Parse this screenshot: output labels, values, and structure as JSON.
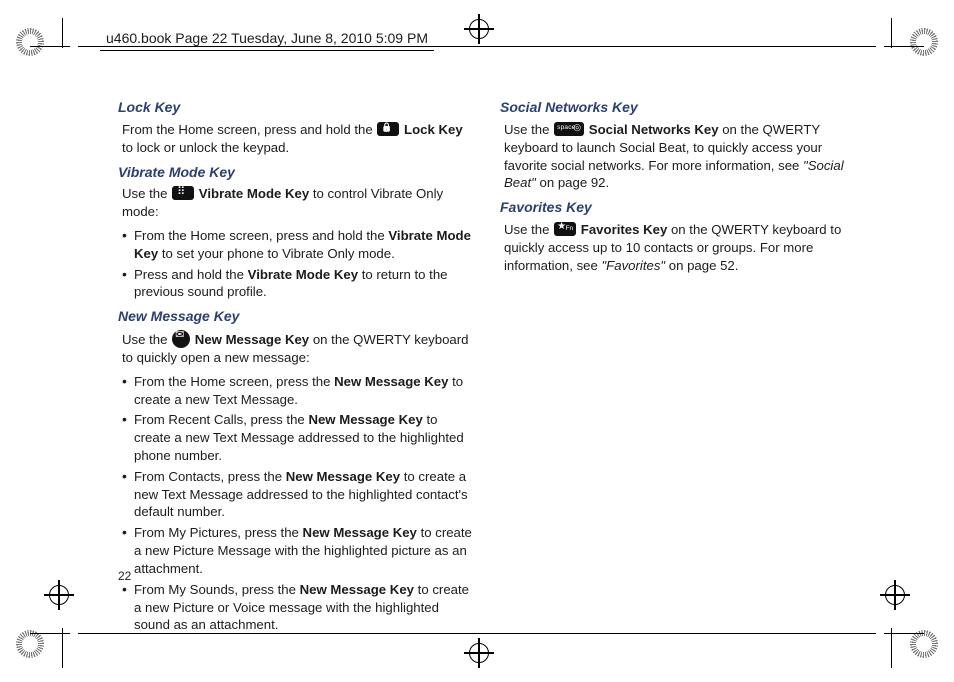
{
  "running_header": "u460.book  Page 22  Tuesday, June 8, 2010  5:09 PM",
  "page_number": "22",
  "left": {
    "lock": {
      "heading": "Lock Key",
      "p1a": "From the Home screen, press and hold the ",
      "p1b": " Lock Key",
      "p1c": " to lock or unlock the keypad."
    },
    "vibrate": {
      "heading": "Vibrate Mode Key",
      "p1a": "Use the ",
      "p1b": " Vibrate Mode Key",
      "p1c": " to control Vibrate Only mode:",
      "li1a": "From the Home screen, press and hold the ",
      "li1b": "Vibrate Mode Key",
      "li1c": " to set your phone to Vibrate Only mode.",
      "li2a": "Press and hold the ",
      "li2b": "Vibrate Mode Key",
      "li2c": " to return to the previous sound profile."
    },
    "newmsg": {
      "heading": "New Message Key",
      "p1a": "Use the ",
      "p1b": " New Message Key",
      "p1c": " on the QWERTY keyboard to quickly open a new message:",
      "li1a": "From the Home screen, press the ",
      "li1b": "New Message Key",
      "li1c": " to create a new Text Message.",
      "li2a": "From Recent Calls, press the ",
      "li2b": "New Message Key",
      "li2c": " to create a new Text Message addressed to the highlighted phone number.",
      "li3a": "From Contacts, press the ",
      "li3b": "New Message Key",
      "li3c": " to create a new Text Message addressed to the highlighted contact's default number.",
      "li4a": "From My Pictures, press the ",
      "li4b": "New Message Key",
      "li4c": " to create a new Picture Message with the highlighted picture as an attachment.",
      "li5a": "From My Sounds, press the ",
      "li5b": "New Message Key",
      "li5c": " to create a new Picture or Voice message with the highlighted sound as an attachment."
    }
  },
  "right": {
    "social": {
      "heading": "Social Networks Key",
      "p1a": "Use the ",
      "p1b": " Social Networks Key",
      "p1c": " on the QWERTY keyboard to launch Social Beat, to quickly access your favorite social networks. For more information, see ",
      "ref": "\"Social Beat\"",
      "p1d": " on page 92."
    },
    "fav": {
      "heading": "Favorites Key",
      "p1a": "Use the ",
      "p1b": " Favorites Key",
      "p1c": " on the QWERTY keyboard to quickly access up to 10 contacts or groups. For more information, see ",
      "ref": "\"Favorites\"",
      "p1d": " on page 52."
    }
  }
}
